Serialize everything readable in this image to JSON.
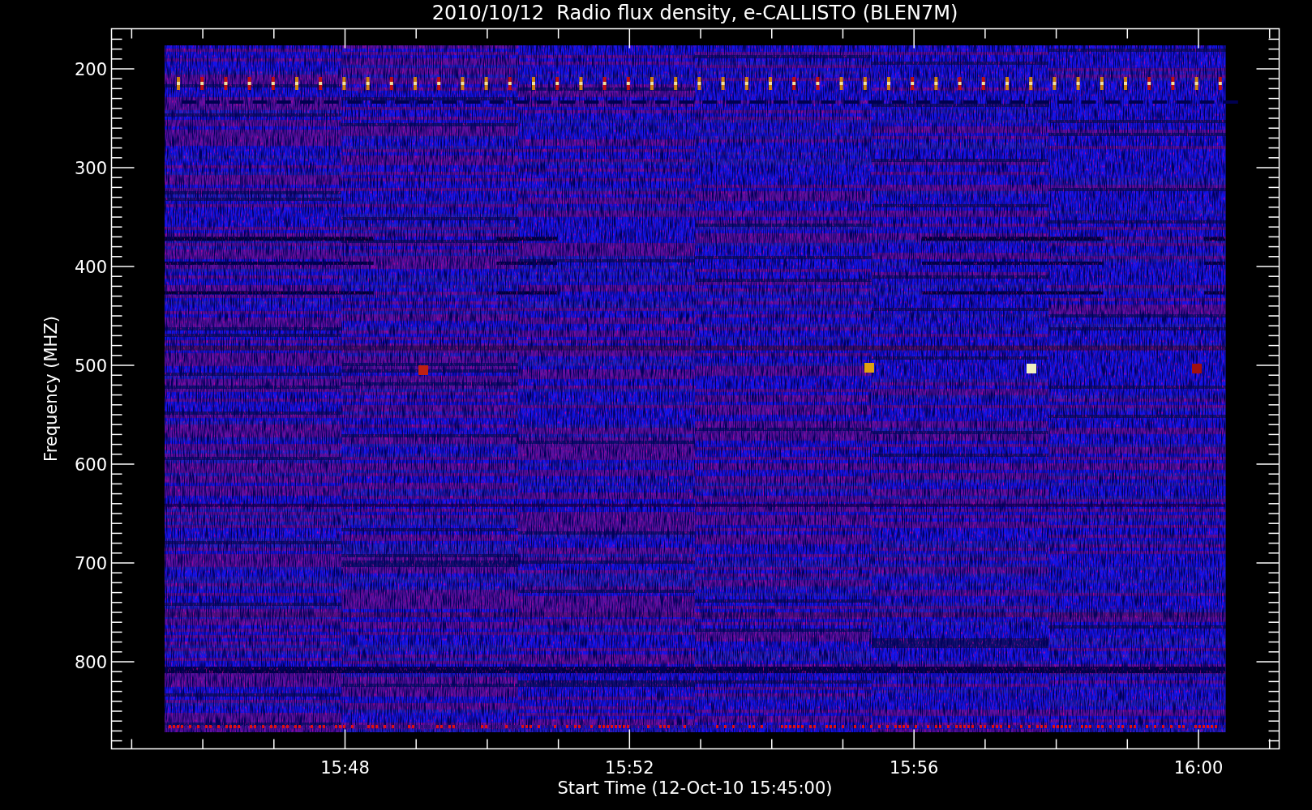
{
  "title": "2010/10/12  Radio flux density, e-CALLISTO (BLEN7M)",
  "y_axis": {
    "label": "Frequency (MHZ)",
    "tick_labels": [
      "200",
      "300",
      "400",
      "500",
      "600",
      "700",
      "800"
    ]
  },
  "x_axis": {
    "label": "Start Time (12-Oct-10 15:45:00)",
    "tick_labels": [
      "15:48",
      "15:52",
      "15:56",
      "16:00"
    ]
  }
}
